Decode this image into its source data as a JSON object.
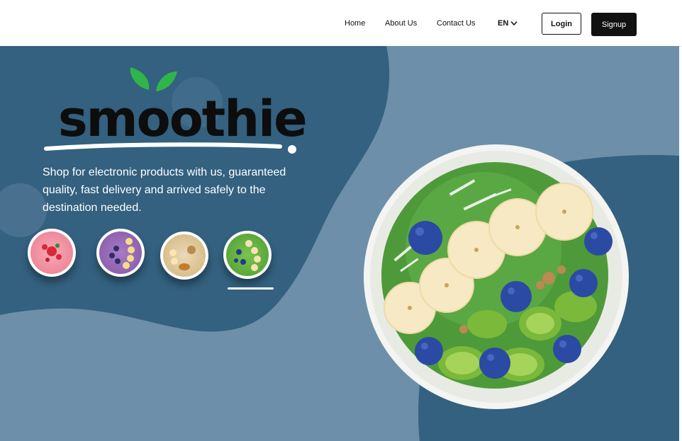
{
  "nav": {
    "links": [
      "Home",
      "About Us",
      "Contact Us"
    ],
    "language": "EN",
    "login_label": "Login",
    "signup_label": "Signup"
  },
  "hero": {
    "logo_text": "smoothie",
    "tagline": "Shop for electronic products with us, guaranteed quality, fast delivery and arrived safely to the destination needed.",
    "thumbnails": [
      {
        "name": "strawberry-smoothie-bowl",
        "active": false
      },
      {
        "name": "blueberry-banana-smoothie-bowl",
        "active": false
      },
      {
        "name": "banana-granola-smoothie-bowl",
        "active": false
      },
      {
        "name": "kiwi-blueberry-smoothie-bowl",
        "active": true
      }
    ]
  },
  "colors": {
    "dark_blue": "#33617f",
    "light_blue": "#6d8fa9",
    "button_dark": "#111111",
    "leaf_green": "#2fb54a"
  }
}
